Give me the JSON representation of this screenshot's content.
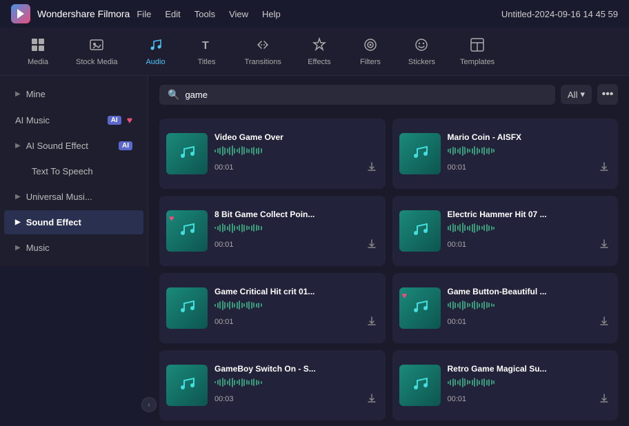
{
  "titlebar": {
    "app_name": "Wondershare Filmora",
    "menu_items": [
      "File",
      "Edit",
      "Tools",
      "View",
      "Help"
    ],
    "project_title": "Untitled-2024-09-16 14 45 59"
  },
  "topnav": {
    "items": [
      {
        "id": "media",
        "label": "Media",
        "icon": "▣",
        "active": false
      },
      {
        "id": "stock-media",
        "label": "Stock Media",
        "icon": "🎬",
        "active": false
      },
      {
        "id": "audio",
        "label": "Audio",
        "icon": "♪",
        "active": true
      },
      {
        "id": "titles",
        "label": "Titles",
        "icon": "T",
        "active": false
      },
      {
        "id": "transitions",
        "label": "Transitions",
        "icon": "↔",
        "active": false
      },
      {
        "id": "effects",
        "label": "Effects",
        "icon": "✦",
        "active": false
      },
      {
        "id": "filters",
        "label": "Filters",
        "icon": "◈",
        "active": false
      },
      {
        "id": "stickers",
        "label": "Stickers",
        "icon": "☀",
        "active": false
      },
      {
        "id": "templates",
        "label": "Templates",
        "icon": "⊞",
        "active": false
      }
    ]
  },
  "sidebar": {
    "items": [
      {
        "id": "mine",
        "label": "Mine",
        "has_arrow": true,
        "badge": null,
        "active": false
      },
      {
        "id": "ai-music",
        "label": "AI Music",
        "has_arrow": false,
        "badge": "AI",
        "badge_type": "ai",
        "active": false
      },
      {
        "id": "ai-sound-effect",
        "label": "AI Sound Effect",
        "has_arrow": false,
        "badge": "AI",
        "badge_type": "ai",
        "active": false
      },
      {
        "id": "text-to-speech",
        "label": "Text To Speech",
        "has_arrow": false,
        "badge": null,
        "active": false
      },
      {
        "id": "universal-music",
        "label": "Universal Musi...",
        "has_arrow": true,
        "badge": null,
        "active": false
      },
      {
        "id": "sound-effect",
        "label": "Sound Effect",
        "has_arrow": false,
        "badge": null,
        "active": true
      },
      {
        "id": "music",
        "label": "Music",
        "has_arrow": true,
        "badge": null,
        "active": false
      }
    ]
  },
  "search": {
    "placeholder": "game",
    "filter_label": "All",
    "more_label": "•••"
  },
  "audio_items": [
    {
      "id": "video-game-over",
      "title": "Video Game Over",
      "duration": "00:01",
      "has_heart": false,
      "wave_heights": [
        4,
        7,
        10,
        14,
        10,
        7,
        12,
        15,
        8,
        5,
        9,
        13,
        11,
        7,
        6,
        9,
        12,
        8,
        10,
        7
      ]
    },
    {
      "id": "mario-coin",
      "title": "Mario Coin - AISFX",
      "duration": "00:01",
      "has_heart": false,
      "wave_heights": [
        5,
        8,
        12,
        9,
        6,
        10,
        14,
        11,
        7,
        5,
        8,
        13,
        10,
        6,
        9,
        12,
        8,
        10,
        7,
        5
      ]
    },
    {
      "id": "8bit-game-collect",
      "title": "8 Bit Game Collect Poin...",
      "duration": "00:01",
      "has_heart": true,
      "wave_heights": [
        3,
        6,
        10,
        13,
        9,
        6,
        11,
        14,
        8,
        5,
        9,
        12,
        10,
        7,
        5,
        8,
        11,
        9,
        7,
        6
      ]
    },
    {
      "id": "electric-hammer",
      "title": "Electric Hammer Hit 07 ...",
      "duration": "00:01",
      "has_heart": false,
      "wave_heights": [
        6,
        9,
        13,
        10,
        7,
        11,
        15,
        9,
        6,
        8,
        12,
        14,
        10,
        7,
        5,
        9,
        11,
        8,
        6,
        4
      ]
    },
    {
      "id": "game-critical-hit",
      "title": "Game Critical Hit crit 01...",
      "duration": "00:01",
      "has_heart": false,
      "wave_heights": [
        4,
        8,
        11,
        14,
        10,
        7,
        12,
        9,
        6,
        10,
        13,
        8,
        5,
        9,
        12,
        10,
        7,
        6,
        8,
        5
      ]
    },
    {
      "id": "game-button-beautiful",
      "title": "Game Button-Beautiful ...",
      "duration": "00:01",
      "has_heart": true,
      "wave_heights": [
        5,
        9,
        12,
        8,
        6,
        10,
        14,
        11,
        7,
        5,
        9,
        13,
        10,
        6,
        8,
        12,
        9,
        7,
        5,
        4
      ]
    },
    {
      "id": "gameboy-switch-on",
      "title": "GameBoy Switch On - S...",
      "duration": "00:03",
      "has_heart": false,
      "wave_heights": [
        3,
        7,
        10,
        13,
        9,
        6,
        11,
        14,
        8,
        5,
        9,
        12,
        10,
        7,
        6,
        9,
        11,
        8,
        6,
        4
      ]
    },
    {
      "id": "retro-game-magical",
      "title": "Retro Game Magical Su...",
      "duration": "00:01",
      "has_heart": false,
      "wave_heights": [
        4,
        8,
        12,
        9,
        6,
        10,
        14,
        11,
        7,
        5,
        8,
        13,
        10,
        6,
        9,
        12,
        8,
        10,
        7,
        5
      ]
    }
  ],
  "colors": {
    "accent": "#4fc3f7",
    "active_bg": "#2a3050",
    "thumb_bg_start": "#1a8a7a",
    "thumb_bg_end": "#0d5550",
    "wave_color": "#3a9a7a",
    "heart_color": "#e94f7b",
    "ai_badge": "#5b67ca"
  }
}
